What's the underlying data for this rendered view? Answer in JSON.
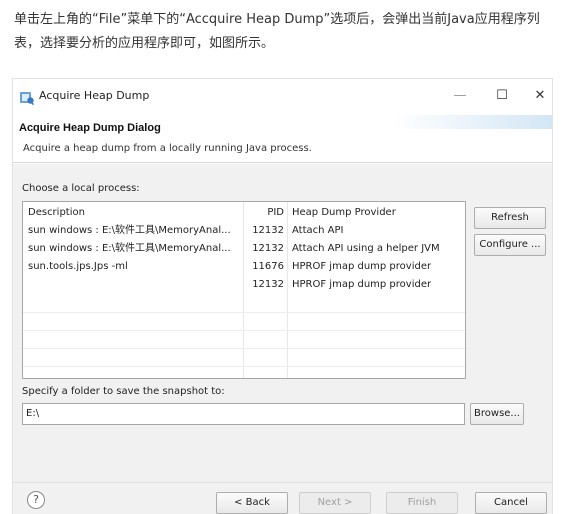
{
  "article": {
    "text": "单击左上角的“File”菜单下的“Accquire Heap Dump”选项后，会弹出当前Java应用程序列表，选择要分析的应用程序即可，如图所示。"
  },
  "window": {
    "title": "Acquire Heap Dump",
    "minimize_glyph": "—",
    "maximize_glyph": "☐",
    "close_glyph": "✕"
  },
  "header": {
    "title": "Acquire Heap Dump Dialog",
    "description": "Acquire a heap dump from a locally running Java process."
  },
  "process_section": {
    "label": "Choose a local process:",
    "columns": [
      "Description",
      "PID",
      "Heap Dump Provider"
    ],
    "rows": [
      {
        "description": "sun windows : E:\\软件工具\\MemoryAnal...",
        "pid": "12132",
        "provider": "Attach API"
      },
      {
        "description": "sun windows : E:\\软件工具\\MemoryAnal...",
        "pid": "12132",
        "provider": "Attach API using a helper JVM"
      },
      {
        "description": "sun.tools.jps.Jps -ml",
        "pid": "11676",
        "provider": "HPROF jmap dump provider"
      },
      {
        "description": "",
        "pid": "12132",
        "provider": "HPROF jmap dump provider"
      }
    ],
    "refresh_label": "Refresh",
    "configure_label": "Configure ..."
  },
  "folder_section": {
    "label": "Specify a folder to save the snapshot to:",
    "value": "E:\\",
    "browse_label": "Browse..."
  },
  "footer": {
    "help_glyph": "?",
    "back_label": "< Back",
    "next_label": "Next >",
    "finish_label": "Finish",
    "cancel_label": "Cancel"
  }
}
